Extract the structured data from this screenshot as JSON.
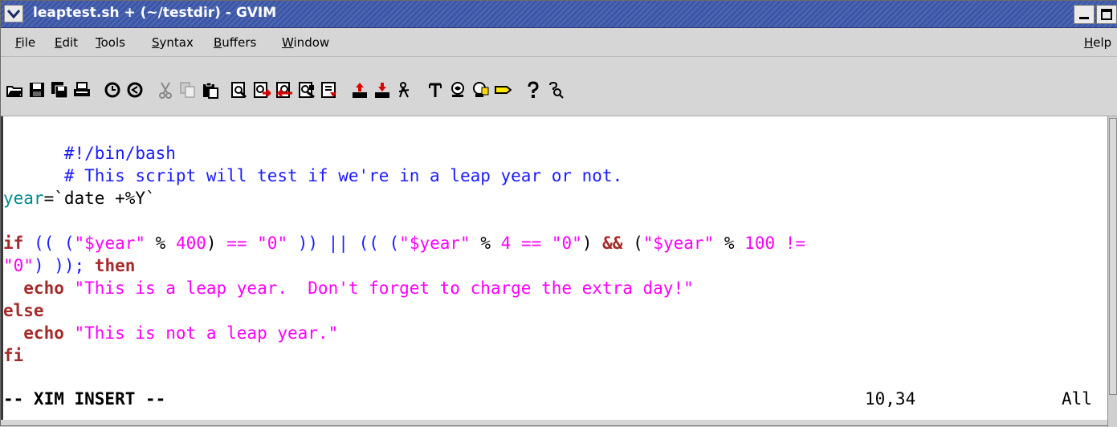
{
  "window": {
    "title": "leaptest.sh + (~/testdir) - GVIM",
    "controls": [
      "minimize",
      "maximize"
    ]
  },
  "menubar": {
    "items": [
      {
        "label": "File"
      },
      {
        "label": "Edit"
      },
      {
        "label": "Tools"
      },
      {
        "label": "Syntax"
      },
      {
        "label": "Buffers"
      },
      {
        "label": "Window"
      },
      {
        "label": "Help"
      }
    ]
  },
  "toolbar": {
    "icons": [
      "open-icon",
      "save-icon",
      "save-all-icon",
      "print-icon",
      "undo-icon",
      "redo-icon",
      "cut-icon",
      "copy-icon",
      "paste-icon",
      "find-icon",
      "find-next-icon",
      "find-prev-icon",
      "replace-icon",
      "load-session-icon",
      "save-session-icon",
      "run-script-icon",
      "make-icon",
      "build-tags-icon",
      "shell-icon",
      "tag-jump-icon",
      "help-icon",
      "find-help-icon"
    ]
  },
  "editor": {
    "lines": {
      "l1": "#!/bin/bash",
      "l2": "# This script will test if we're in a leap year or not.",
      "l4a": "year",
      "l4b": "=`date +%Y`",
      "l6a": "if",
      "l6b": " (( (",
      "l6c": "\"$year\"",
      "l6d": " % ",
      "l6e": "400",
      "l6f": ") ",
      "l6g": "==",
      "l6h": " ",
      "l6i": "\"0\"",
      "l6j": " )) || (( (",
      "l6k": "\"$year\"",
      "l6l": " % ",
      "l6m": "4",
      "l6n": " ",
      "l6o": "==",
      "l6p": " ",
      "l6q": "\"0\"",
      "l6r": ") ",
      "l6s": "&&",
      "l6t": " (",
      "l6u": "\"$year\"",
      "l6v": " % ",
      "l6w": "100",
      "l6x": " !=",
      "l7a": "\"0\"",
      "l7b": ") ));",
      "l7c": " then",
      "l8a": "  echo",
      "l8b": " \"This is a leap year.  Don't forget to charge the extra day!\"",
      "l9": "else",
      "l10a": "  echo",
      "l10b": " \"This is not a leap year.\"",
      "l11": "fi"
    },
    "status": {
      "mode": "-- XIM INSERT --",
      "position": "10,34",
      "scroll": "All"
    }
  }
}
